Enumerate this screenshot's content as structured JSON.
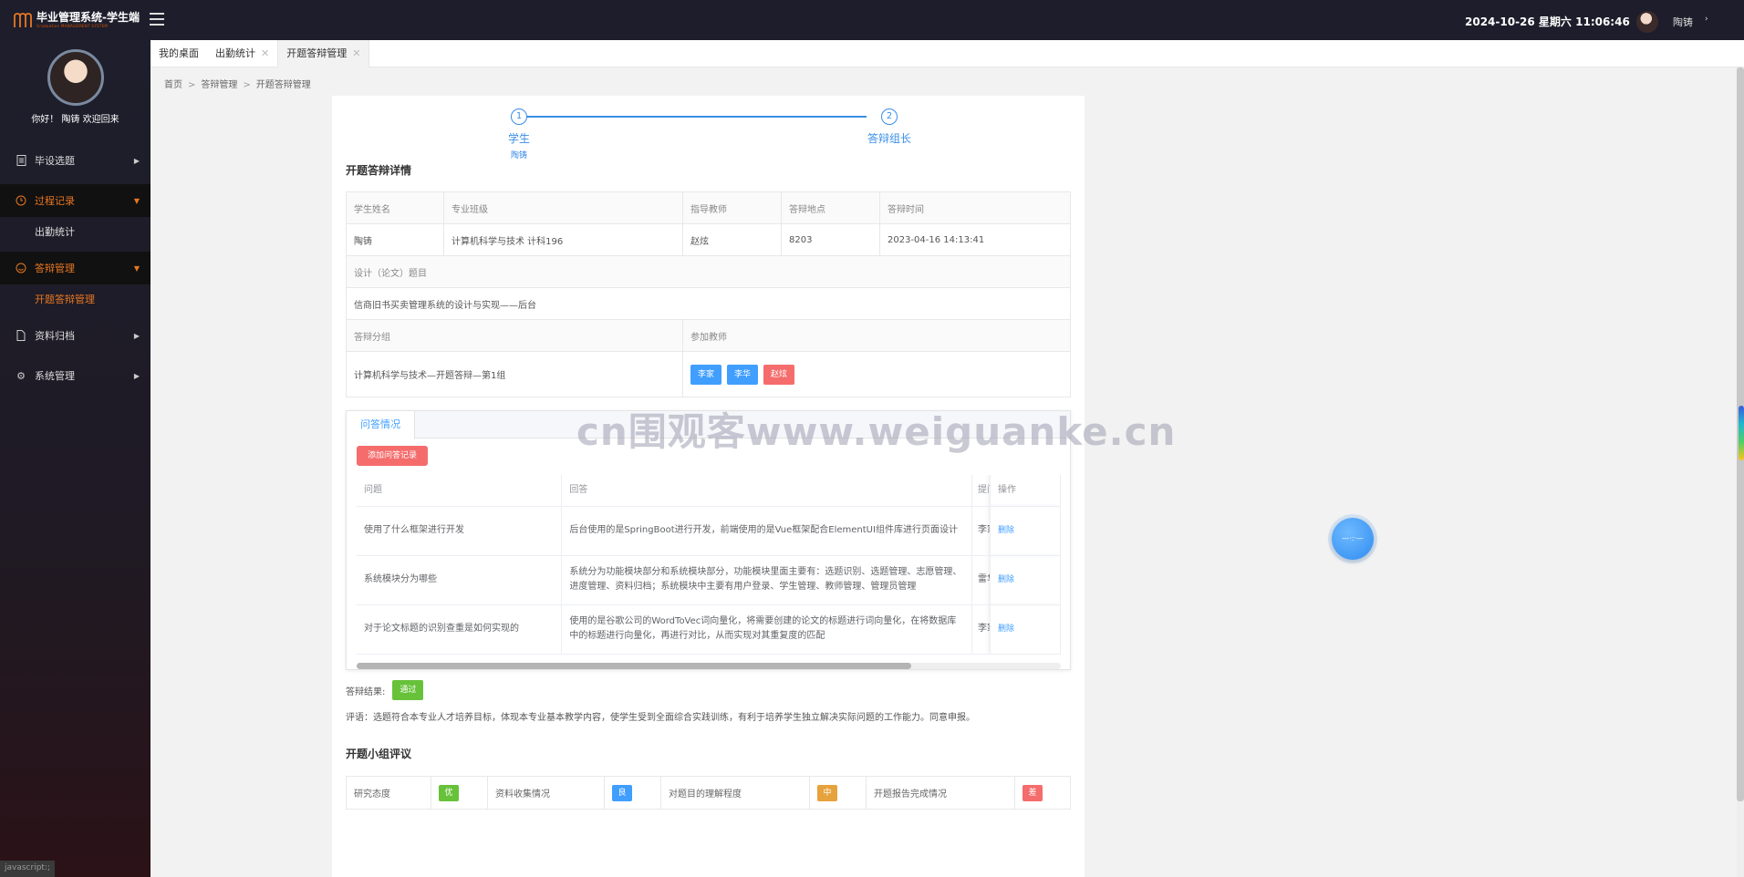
{
  "header": {
    "app_title": "毕业管理系统-学生端",
    "app_subtitle": "Graduation MANAGEMENT SYSTEM",
    "datetime": "2024-10-26  星期六  11:06:46",
    "user": "陶铸",
    "caret": "›"
  },
  "sidebar": {
    "greeting": "你好！ 陶铸 欢迎回来",
    "menu": [
      {
        "label": "毕设选题",
        "icon": "document-icon"
      },
      {
        "label": "过程记录",
        "icon": "clock-icon",
        "children": [
          "出勤统计"
        ]
      },
      {
        "label": "答辩管理",
        "icon": "smile-icon",
        "children": [
          "开题答辩管理"
        ]
      },
      {
        "label": "资料归档",
        "icon": "file-icon"
      },
      {
        "label": "系统管理",
        "icon": "gear-icon"
      }
    ],
    "status": "javascript:;"
  },
  "tabs": [
    {
      "label": "我的桌面"
    },
    {
      "label": "出勤统计",
      "close": "✕"
    },
    {
      "label": "开题答辩管理",
      "close": "✕"
    }
  ],
  "breadcrumb": [
    "首页",
    "答辩管理",
    "开题答辩管理"
  ],
  "breadcrumb_sep": ">",
  "steps": [
    {
      "num": "1",
      "title": "学生",
      "desc": "陶铸"
    },
    {
      "num": "2",
      "title": "答辩组长",
      "desc": ""
    }
  ],
  "detail": {
    "title": "开题答辩详情",
    "headers": [
      "学生姓名",
      "专业班级",
      "指导教师",
      "答辩地点",
      "答辩时间"
    ],
    "values": [
      "陶铸",
      "计算机科学与技术 计科196",
      "赵炫",
      "8203",
      "2023-04-16 14:13:41"
    ],
    "topic_label": "设计（论文）题目",
    "topic": "信商旧书买卖管理系统的设计与实现——后台",
    "group_label": "答辩分组",
    "teachers_label": "参加教师",
    "group": "计算机科学与技术—开题答辩—第1组",
    "teachers": [
      "李家",
      "李华",
      "赵炫"
    ]
  },
  "qa": {
    "tab": "问答情况",
    "add_button": "添加问答记录",
    "headers": [
      "问题",
      "回答",
      "提问",
      "操作"
    ],
    "rows": [
      {
        "q": "使用了什么框架进行开发",
        "a": "后台使用的是SpringBoot进行开发，前端使用的是Vue框架配合ElementUI组件库进行页面设计",
        "asker": "李家",
        "op": "删除"
      },
      {
        "q": "系统模块分为哪些",
        "a": "系统分为功能模块部分和系统模块部分，功能模块里面主要有：选题识别、选题管理、志愿管理、进度管理、资料归档；系统模块中主要有用户登录、学生管理、教师管理、管理员管理",
        "asker": "雷华",
        "op": "删除"
      },
      {
        "q": "对于论文标题的识别查重是如何实现的",
        "a": "使用的是谷歌公司的WordToVec词向量化，将需要创建的论文的标题进行词向量化，在将数据库中的标题进行向量化，再进行对比，从而实现对其重复度的匹配",
        "asker": "李家",
        "op": "删除"
      }
    ]
  },
  "result": {
    "label": "答辩结果:",
    "value": "通过",
    "comment": "评语：选题符合本专业人才培养目标，体现本专业基本教学内容，使学生受到全面综合实践训练，有利于培养学生独立解决实际问题的工作能力。同意申报。"
  },
  "evaluation": {
    "title": "开题小组评议",
    "items": [
      {
        "label": "研究态度",
        "grade": "优",
        "color": "#67c23a"
      },
      {
        "label": "资料收集情况",
        "grade": "良",
        "color": "#409eff"
      },
      {
        "label": "对题目的理解程度",
        "grade": "中",
        "color": "#e6a23c"
      },
      {
        "label": "开题报告完成情况",
        "grade": "差",
        "color": "#f56c6c"
      }
    ]
  },
  "watermark": "cn围观客www.weiguanke.cn",
  "float_ball": "—·:·—"
}
